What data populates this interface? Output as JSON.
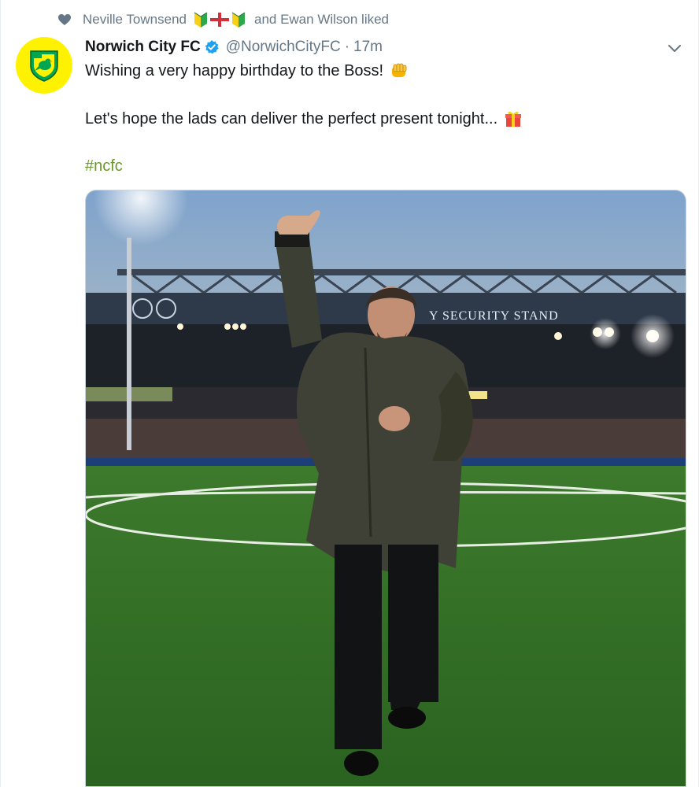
{
  "context": {
    "icon": "heart-icon",
    "first_liker": "Neville Townsend",
    "emoji_icons": [
      "beginner-badge-icon",
      "england-flag-icon",
      "beginner-badge-icon"
    ],
    "rest": "and Ewan Wilson liked"
  },
  "tweet": {
    "avatar_icon": "norwich-city-crest-icon",
    "display_name": "Norwich City FC",
    "verified_icon": "verified-badge-icon",
    "handle": "@NorwichCityFC",
    "separator": "·",
    "time": "17m",
    "line1": "Wishing a very happy birthday to the Boss!",
    "line1_emoji": "fist-bump-icon",
    "line2": "Let's hope the lads can deliver the perfect present tonight...",
    "line2_emoji": "wrapped-gift-icon",
    "hashtag": "#ncfc"
  },
  "photo": {
    "stand_sign": "Y SECURITY STAND",
    "description_icon": "stadium-photo"
  },
  "colors": {
    "accent_green": "#6a9a2a",
    "secondary_text": "#657786",
    "verified_blue": "#1da1f2",
    "avatar_yellow": "#fff200"
  }
}
